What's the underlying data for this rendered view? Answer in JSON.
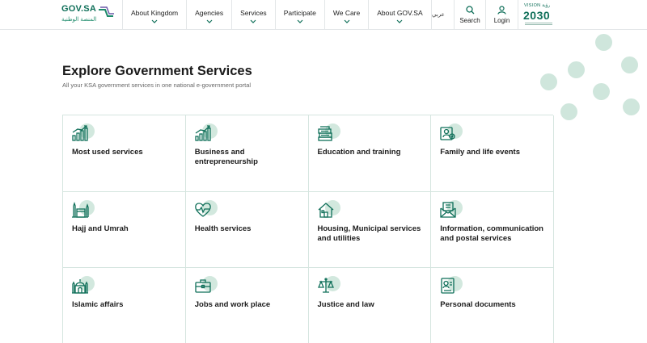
{
  "header": {
    "logo_text": "GOV.SA",
    "logo_sub": "المنصة الوطنية",
    "nav": [
      {
        "label": "About Kingdom"
      },
      {
        "label": "Agencies"
      },
      {
        "label": "Services"
      },
      {
        "label": "Participate"
      },
      {
        "label": "We Care"
      },
      {
        "label": "About GOV.SA"
      }
    ],
    "language": "عربي",
    "search_label": "Search",
    "login_label": "Login",
    "vision_top": "VISION رؤية",
    "vision_year": "2030"
  },
  "main": {
    "title": "Explore Government Services",
    "subtitle": "All your KSA government services in one national e-government portal",
    "categories": [
      {
        "label": "Most used services",
        "icon": "bar-chart-icon"
      },
      {
        "label": "Business and entrepreneurship",
        "icon": "growth-chart-icon"
      },
      {
        "label": "Education and training",
        "icon": "books-icon"
      },
      {
        "label": "Family and life events",
        "icon": "family-icon"
      },
      {
        "label": "Hajj and Umrah",
        "icon": "kaaba-icon"
      },
      {
        "label": "Health services",
        "icon": "heartbeat-icon"
      },
      {
        "label": "Housing, Municipal services and utilities",
        "icon": "house-icon"
      },
      {
        "label": "Information, communication and postal services",
        "icon": "envelope-icon"
      },
      {
        "label": "Islamic affairs",
        "icon": "mosque-icon"
      },
      {
        "label": "Jobs and work place",
        "icon": "briefcase-icon"
      },
      {
        "label": "Justice and law",
        "icon": "scales-icon"
      },
      {
        "label": "Personal documents",
        "icon": "document-icon"
      }
    ]
  },
  "colors": {
    "brand_green": "#0f6f59",
    "accent_light": "#d2e8de",
    "border": "#d5e5df"
  }
}
